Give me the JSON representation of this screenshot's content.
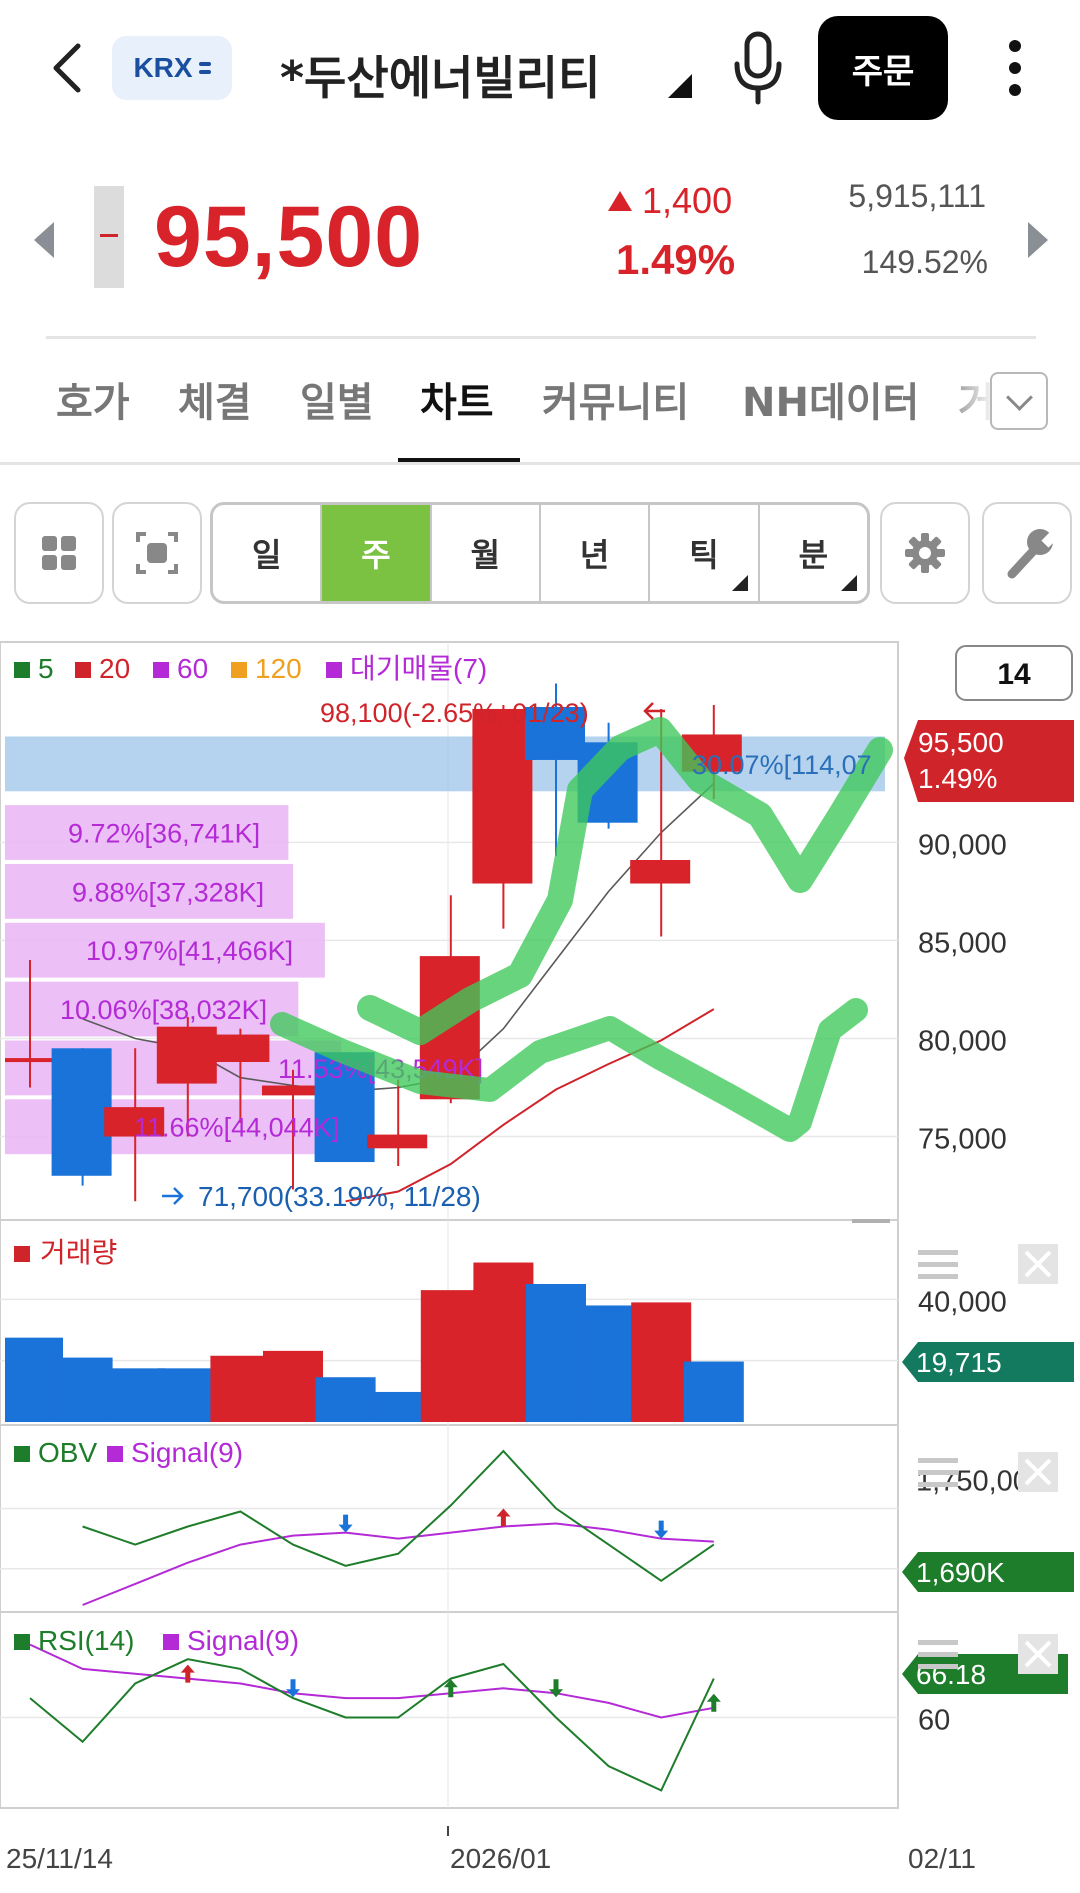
{
  "header": {
    "exchange_badge": "KRX",
    "stock_name": "*두산에너빌리티",
    "order_button": "주문"
  },
  "quote": {
    "price": "95,500",
    "change": "1,400",
    "change_pct": "1.49%",
    "volume": "5,915,111",
    "turnover_pct": "149.52%"
  },
  "tabs": [
    {
      "label": "호가",
      "active": false
    },
    {
      "label": "체결",
      "active": false
    },
    {
      "label": "일별",
      "active": false
    },
    {
      "label": "차트",
      "active": true
    },
    {
      "label": "커뮤니티",
      "active": false
    },
    {
      "label": "NH데이터",
      "active": false
    },
    {
      "label": "거",
      "active": false
    }
  ],
  "periods": [
    {
      "label": "일",
      "active": false,
      "has_menu": false
    },
    {
      "label": "주",
      "active": true,
      "has_menu": false
    },
    {
      "label": "월",
      "active": false,
      "has_menu": false
    },
    {
      "label": "년",
      "active": false,
      "has_menu": false
    },
    {
      "label": "틱",
      "active": false,
      "has_menu": true
    },
    {
      "label": "분",
      "active": false,
      "has_menu": true
    }
  ],
  "colors": {
    "up": "#d8232a",
    "down": "#1a73d9",
    "ma5": "#1e7d2a",
    "ma20": "#d0242b",
    "ma60": "#b32ad6",
    "ma120": "#f0a020",
    "vp": "#b32ad6",
    "accent_period": "#7cc242",
    "highlight": "#3ec95a"
  },
  "icons": [
    "back-arrow-icon",
    "microphone-icon",
    "more-vertical-icon",
    "grid-layout-icon",
    "screen-capture-icon",
    "gear-icon",
    "wrench-icon",
    "chevron-down-icon",
    "hamburger-menu-icon",
    "close-icon"
  ],
  "chart_data": [
    {
      "type": "candlestick",
      "legend": [
        {
          "label": "5",
          "color": "#1e7d2a"
        },
        {
          "label": "20",
          "color": "#d0242b"
        },
        {
          "label": "60",
          "color": "#b32ad6"
        },
        {
          "label": "120",
          "color": "#f0a020"
        },
        {
          "label": "대기매물(7)",
          "color": "#b32ad6"
        }
      ],
      "period_box": "14",
      "x_labels": [
        "25/11/14",
        "2026/01",
        "02/11"
      ],
      "ylim": [
        71000,
        99500
      ],
      "y_ticks": [
        75000,
        80000,
        85000,
        90000
      ],
      "y_tick_labels": [
        "75,000",
        "80,000",
        "85,000",
        "90,000"
      ],
      "candles": [
        {
          "o": 79000,
          "h": 84000,
          "l": 77500,
          "c": 79000
        },
        {
          "o": 79500,
          "h": 79500,
          "l": 72500,
          "c": 73000
        },
        {
          "o": 75000,
          "h": 79500,
          "l": 71700,
          "c": 76500
        },
        {
          "o": 77700,
          "h": 81100,
          "l": 75000,
          "c": 80600
        },
        {
          "o": 78800,
          "h": 80500,
          "l": 75700,
          "c": 80200
        },
        {
          "o": 77100,
          "h": 78400,
          "l": 72300,
          "c": 77600
        },
        {
          "o": 79300,
          "h": 79300,
          "l": 73700,
          "c": 73700
        },
        {
          "o": 74400,
          "h": 77900,
          "l": 73500,
          "c": 75100
        },
        {
          "o": 76900,
          "h": 87300,
          "l": 76700,
          "c": 84200
        },
        {
          "o": 87900,
          "h": 97000,
          "l": 85600,
          "c": 96800
        },
        {
          "o": 96900,
          "h": 98100,
          "l": 89300,
          "c": 94200
        },
        {
          "o": 95100,
          "h": 96100,
          "l": 90700,
          "c": 91000
        },
        {
          "o": 87900,
          "h": 96800,
          "l": 85200,
          "c": 89100
        },
        {
          "o": 93600,
          "h": 97000,
          "l": 92200,
          "c": 95500
        }
      ],
      "ma5": [
        null,
        81000,
        80000,
        79500,
        78000,
        77600,
        77300,
        77500,
        78000,
        80500,
        84000,
        87500,
        90500,
        93000
      ],
      "ma20": [
        null,
        null,
        null,
        null,
        null,
        null,
        71700,
        72200,
        73600,
        75600,
        77400,
        78700,
        79900,
        81500
      ],
      "high_annotation": "98,100(-2.65%, 01/23)",
      "low_annotation": "71,700(33.19%, 11/28)",
      "volume_profile": [
        {
          "label": "9.72%[36,741K]",
          "pct": 9.72,
          "from": 89000,
          "to": 92000
        },
        {
          "label": "9.88%[37,328K]",
          "pct": 9.88,
          "from": 86000,
          "to": 89000
        },
        {
          "label": "10.97%[41,466K]",
          "pct": 10.97,
          "from": 83000,
          "to": 86000
        },
        {
          "label": "10.06%[38,032K]",
          "pct": 10.06,
          "from": 80000,
          "to": 83000
        },
        {
          "label": "11.53%[43,549K]",
          "pct": 11.53,
          "from": 77000,
          "to": 80000
        },
        {
          "label": "11.66%[44,044K]",
          "pct": 11.66,
          "from": 74000,
          "to": 77000
        },
        {
          "label": "30.07%[114,07",
          "pct": 30.07,
          "from": 92500,
          "to": 95500
        }
      ],
      "last_price_tag": "95,500",
      "last_pct_tag": "1.49%"
    },
    {
      "type": "bar",
      "title": "거래량",
      "values": [
        27500,
        21000,
        17500,
        17500,
        21600,
        23200,
        14600,
        9800,
        43000,
        52000,
        45000,
        38000,
        39000,
        19715
      ],
      "up": [
        false,
        false,
        false,
        false,
        true,
        true,
        false,
        false,
        true,
        true,
        false,
        false,
        true,
        false
      ],
      "ylim": [
        0,
        60000
      ],
      "y_ticks": [
        20000,
        40000
      ],
      "y_tick_labels": [
        "",
        "40,000"
      ],
      "last_tag": "19,715"
    },
    {
      "type": "line",
      "legend": [
        {
          "label": "OBV",
          "color": "#1e7d2a"
        },
        {
          "label": "Signal(9)",
          "color": "#b32ad6"
        }
      ],
      "obv": [
        1720000,
        1690000,
        1720000,
        1745000,
        1690000,
        1655000,
        1675000,
        1755000,
        1845000,
        1750000,
        1690000,
        1630000,
        1690000
      ],
      "signal": [
        1590000,
        1625000,
        1660000,
        1690000,
        1705000,
        1710000,
        1700000,
        1710000,
        1720000,
        1725000,
        1715000,
        1700000,
        1695000
      ],
      "ylim": [
        1585000,
        1880000
      ],
      "y_ticks": [
        1750000
      ],
      "y_tick_labels": [
        "1,750,000"
      ],
      "signals": [
        {
          "index": 5,
          "dir": "down"
        },
        {
          "index": 8,
          "dir": "up"
        },
        {
          "index": 11,
          "dir": "down"
        }
      ],
      "last_tag": "1,690K"
    },
    {
      "type": "line",
      "legend": [
        {
          "label": "RSI(14)",
          "color": "#1e7d2a"
        },
        {
          "label": "Signal(9)",
          "color": "#b32ad6"
        }
      ],
      "rsi": [
        64,
        55,
        67,
        72,
        70,
        64,
        60,
        60,
        68,
        71,
        60,
        50,
        45,
        68
      ],
      "signal": [
        75,
        70,
        69,
        68,
        67,
        65,
        64,
        64,
        65,
        66,
        65,
        63,
        60,
        62
      ],
      "ylim": [
        42,
        78
      ],
      "y_ticks": [
        60
      ],
      "y_tick_labels": [
        "60"
      ],
      "signals": [
        {
          "index": 3,
          "dir": "up"
        },
        {
          "index": 5,
          "dir": "down"
        },
        {
          "index": 8,
          "dir": "up"
        },
        {
          "index": 10,
          "dir": "down"
        },
        {
          "index": 13,
          "dir": "up"
        }
      ],
      "last_tag": "66.18"
    }
  ]
}
